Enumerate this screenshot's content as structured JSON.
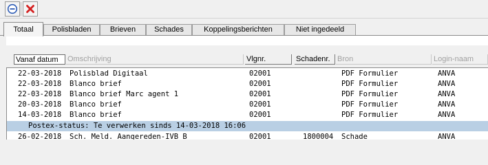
{
  "toolbar": {
    "buttons": [
      {
        "icon": "minus-circle-icon",
        "color": "#2d5bb5"
      },
      {
        "icon": "red-x-icon",
        "color": "#d42020"
      }
    ]
  },
  "tabs": [
    {
      "label": "Totaal",
      "active": true
    },
    {
      "label": "Polisbladen"
    },
    {
      "label": "Brieven"
    },
    {
      "label": "Schades"
    },
    {
      "label": "Koppelingsberichten"
    },
    {
      "label": "Niet ingedeeld"
    }
  ],
  "columns": {
    "vanaf_datum": "Vanaf datum",
    "omschrijving": "Omschrijving",
    "vlgnr": "Vlgnr.",
    "schadenr": "Schadenr.",
    "bron": "Bron",
    "login_naam": "Login-naam"
  },
  "rows": [
    {
      "date": "22-03-2018",
      "desc": "Polisblad Digitaal",
      "vlgnr": "02001",
      "schadenr": "",
      "bron": "PDF Formulier",
      "login": "ANVA"
    },
    {
      "date": "22-03-2018",
      "desc": "Blanco brief",
      "vlgnr": "02001",
      "schadenr": "",
      "bron": "PDF Formulier",
      "login": "ANVA"
    },
    {
      "date": "22-03-2018",
      "desc": "Blanco brief Marc agent 1",
      "vlgnr": "02001",
      "schadenr": "",
      "bron": "PDF Formulier",
      "login": "ANVA"
    },
    {
      "date": "20-03-2018",
      "desc": "Blanco brief",
      "vlgnr": "02001",
      "schadenr": "",
      "bron": "PDF Formulier",
      "login": "ANVA"
    },
    {
      "date": "14-03-2018",
      "desc": "Blanco brief",
      "vlgnr": "02001",
      "schadenr": "",
      "bron": "PDF Formulier",
      "login": "ANVA"
    }
  ],
  "postex_status": "Postex-status: Te verwerken sinds 14-03-2018 16:06",
  "last_row": {
    "date": "26-02-2018",
    "desc": "Sch. Meld. Aangereden-IVB B",
    "vlgnr": "02001",
    "schadenr": "1800004",
    "bron": "Schade",
    "login": "ANVA"
  }
}
